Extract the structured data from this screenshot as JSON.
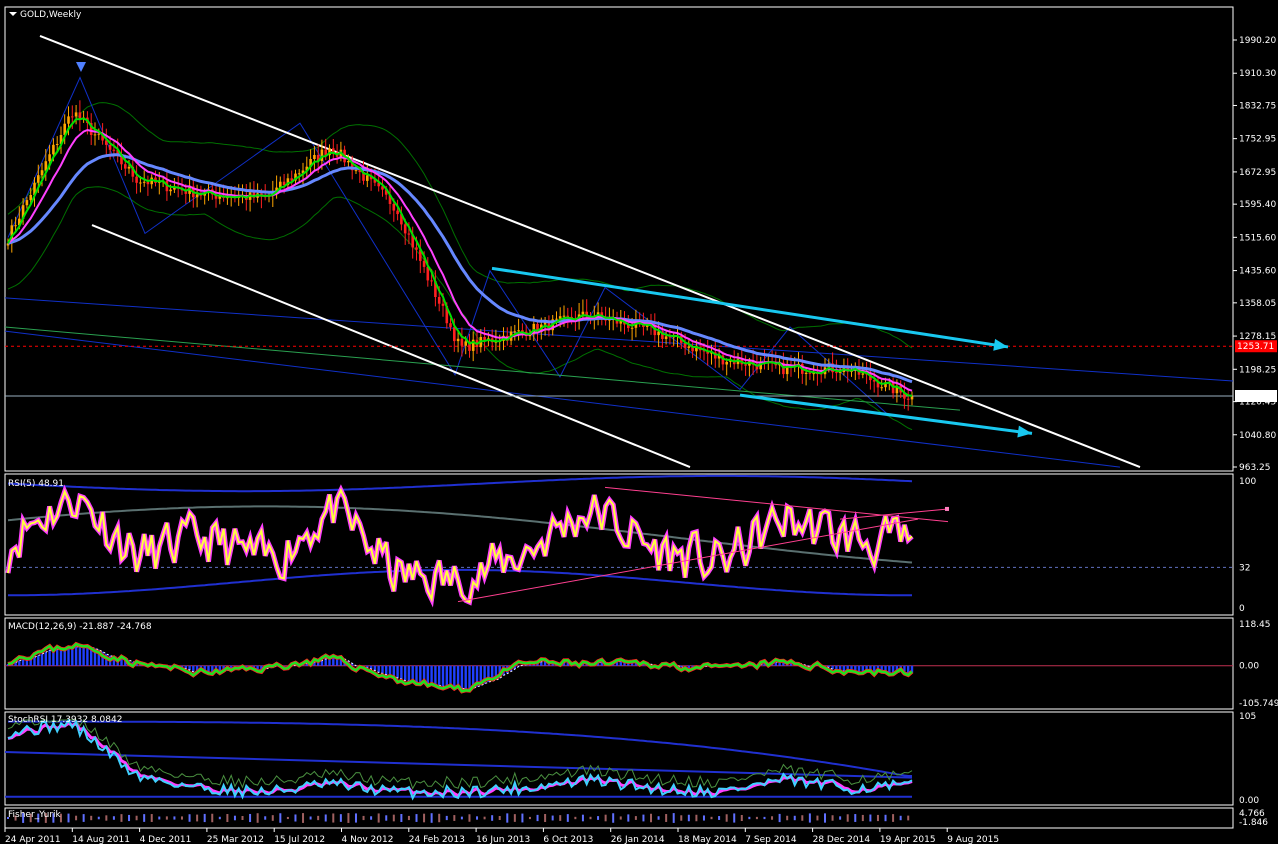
{
  "colors": {
    "background": "#000000",
    "frame": "#ffffff",
    "bull_candle": "#ffa500",
    "bear_candle": "#ff2020",
    "ma_fast": "#00e000",
    "ma_mid": "#ff40ff",
    "ma_slow": "#6688ff",
    "bollinger": "#007000",
    "trend_white": "#ffffff",
    "trend_cyan": "#19c8f0",
    "trend_blue": "#1030c8",
    "rsi": "#ffff40",
    "rsi_pink": "#ff40ff",
    "macd_hist": "#2040ff",
    "macd_line": "#20e020",
    "stoch_cyan": "#40d0ff",
    "price_red_label": "#ff0000"
  },
  "main": {
    "title": "GOLD,Weekly",
    "price_labels": [
      "1990.20",
      "1910.30",
      "1832.75",
      "1752.95",
      "1672.95",
      "1595.40",
      "1515.60",
      "1435.60",
      "1358.05",
      "1278.15",
      "1198.25",
      "1120.45",
      "1040.80",
      "963.25"
    ],
    "current_price": "1134.01",
    "red_marker_price": "1253.71"
  },
  "x_axis": {
    "labels": [
      "24 Apr 2011",
      "14 Aug 2011",
      "4 Dec 2011",
      "25 Mar 2012",
      "15 Jul 2012",
      "4 Nov 2012",
      "24 Feb 2013",
      "16 Jun 2013",
      "6 Oct 2013",
      "26 Jan 2014",
      "18 May 2014",
      "7 Sep 2014",
      "28 Dec 2014",
      "19 Apr 2015",
      "9 Aug 2015"
    ]
  },
  "rsi_panel": {
    "label": "RSI(5) 48.91",
    "levels": [
      "100",
      "32",
      "0"
    ]
  },
  "macd_panel": {
    "label": "MACD(12,26,9) -21.887 -24.768",
    "levels": [
      "118.45",
      "0.00",
      "-105.749"
    ]
  },
  "stoch_panel": {
    "label": "StochRSI 17.3932 8.0842",
    "levels": [
      "105",
      "0.00"
    ]
  },
  "fisher_panel": {
    "label": "Fisher_Yurik",
    "levels": [
      "4.766",
      "-1.846"
    ]
  },
  "chart_data": [
    {
      "type": "candlestick",
      "title": "GOLD,Weekly",
      "x": [
        "24 Apr 2011",
        "14 Aug 2011",
        "4 Dec 2011",
        "25 Mar 2012",
        "15 Jul 2012",
        "4 Nov 2012",
        "24 Feb 2013",
        "16 Jun 2013",
        "6 Oct 2013",
        "26 Jan 2014",
        "18 May 2014",
        "7 Sep 2014",
        "28 Dec 2014",
        "19 Apr 2015",
        "9 Aug 2015"
      ],
      "ylim": [
        963.25,
        1990.2
      ],
      "series": [
        {
          "values": [
            1515,
            1820,
            1655,
            1620,
            1610,
            1735,
            1590,
            1250,
            1290,
            1330,
            1290,
            1225,
            1200,
            1200,
            1130
          ]
        }
      ]
    },
    {
      "type": "line",
      "title": "RSI(5) 48.91",
      "ylim": [
        0,
        100
      ],
      "series": [
        {
          "values": [
            55,
            90,
            40,
            55,
            35,
            80,
            25,
            20,
            45,
            80,
            45,
            35,
            70,
            55,
            48.91
          ]
        }
      ]
    },
    {
      "type": "line",
      "title": "MACD(12,26,9) -21.887 -24.768",
      "ylim": [
        -105.749,
        118.45
      ],
      "series": [
        {
          "values": [
            20,
            60,
            5,
            -20,
            -5,
            20,
            -40,
            -70,
            10,
            5,
            5,
            -10,
            10,
            -15,
            -21.887
          ]
        },
        {
          "values": [
            15,
            50,
            10,
            -15,
            -10,
            15,
            -30,
            -60,
            0,
            0,
            0,
            -10,
            0,
            -15,
            -24.768
          ]
        }
      ]
    },
    {
      "type": "line",
      "title": "StochRSI 17.3932 8.0842",
      "ylim": [
        0,
        105
      ],
      "series": [
        {
          "values": [
            85,
            95,
            30,
            15,
            10,
            20,
            10,
            10,
            15,
            25,
            15,
            10,
            25,
            15,
            17.3932
          ]
        },
        {
          "values": [
            80,
            90,
            25,
            10,
            8,
            15,
            8,
            8,
            12,
            20,
            12,
            8,
            20,
            12,
            8.0842
          ]
        }
      ]
    }
  ]
}
